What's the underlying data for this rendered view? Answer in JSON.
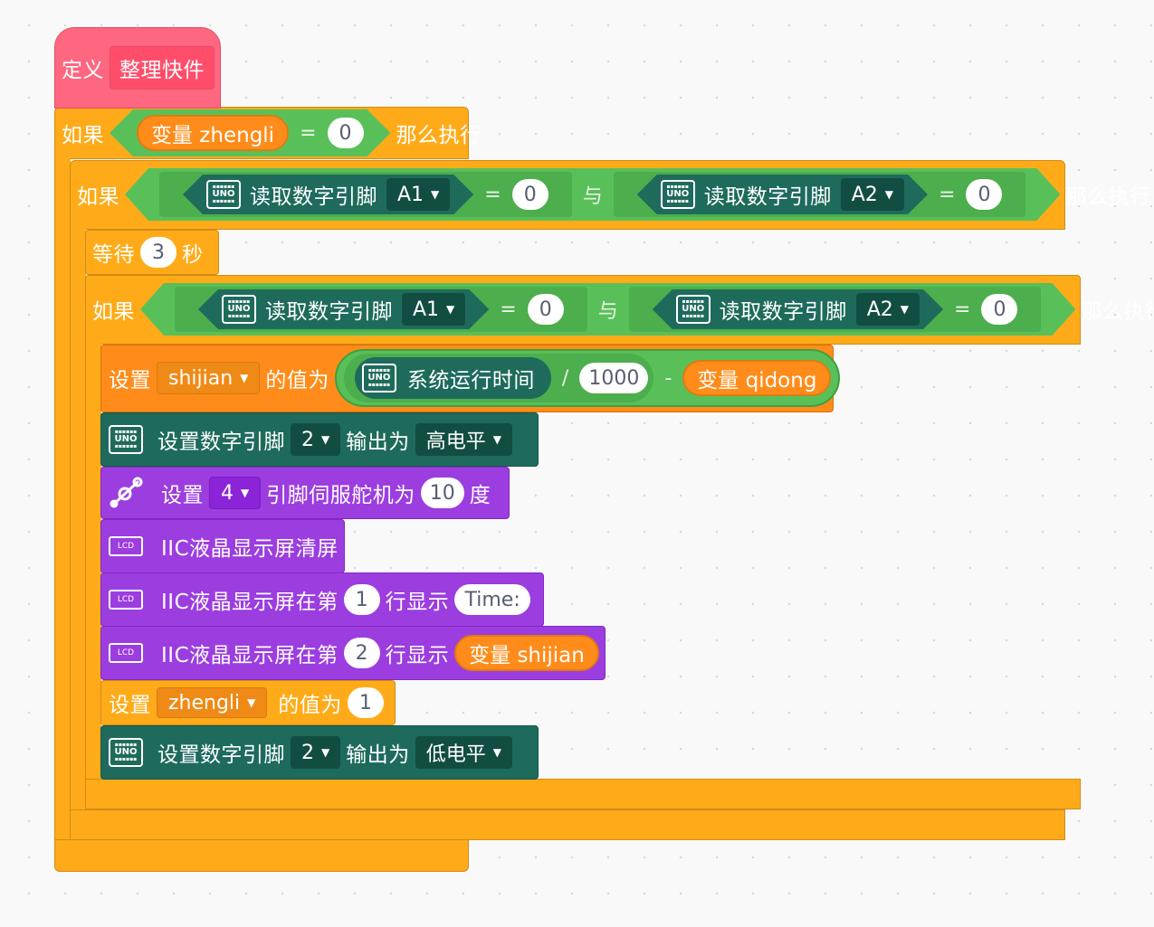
{
  "define": {
    "keyword": "定义",
    "name": "整理快件"
  },
  "outer_if": {
    "keyword": "如果",
    "variable": "变量 zhengli",
    "eq": "=",
    "value": "0",
    "then": "那么执行"
  },
  "if2": {
    "keyword": "如果",
    "left": {
      "label": "读取数字引脚",
      "pin": "A1",
      "eq": "=",
      "value": "0"
    },
    "and": "与",
    "right": {
      "label": "读取数字引脚",
      "pin": "A2",
      "eq": "=",
      "value": "0"
    },
    "then": "那么执行"
  },
  "wait": {
    "keyword": "等待",
    "value": "3",
    "unit": "秒"
  },
  "if3": {
    "keyword": "如果",
    "left": {
      "label": "读取数字引脚",
      "pin": "A1",
      "eq": "=",
      "value": "0"
    },
    "and": "与",
    "right": {
      "label": "读取数字引脚",
      "pin": "A2",
      "eq": "=",
      "value": "0"
    },
    "then": "那么执行"
  },
  "set_shijian": {
    "keyword": "设置",
    "var": "shijian",
    "value_of": "的值为",
    "runtime": "系统运行时间",
    "div": "/",
    "divisor": "1000",
    "minus": "-",
    "var2": "变量 qidong"
  },
  "digital_high": {
    "label": "设置数字引脚",
    "pin": "2",
    "output": "输出为",
    "level": "高电平"
  },
  "servo": {
    "keyword": "设置",
    "pin": "4",
    "label": "引脚伺服舵机为",
    "value": "10",
    "unit": "度"
  },
  "lcd_clear": {
    "label": "IIC液晶显示屏清屏"
  },
  "lcd_line1": {
    "label": "IIC液晶显示屏在第",
    "line": "1",
    "show": "行显示",
    "text": "Time:"
  },
  "lcd_line2": {
    "label": "IIC液晶显示屏在第",
    "line": "2",
    "show": "行显示",
    "var": "变量 shijian"
  },
  "set_zhengli": {
    "keyword": "设置",
    "var": "zhengli",
    "value_of": "的值为",
    "value": "1"
  },
  "digital_low": {
    "label": "设置数字引脚",
    "pin": "2",
    "output": "输出为",
    "level": "低电平"
  },
  "icons": {
    "uno": "UNO",
    "lcd": "LCD"
  },
  "colors": {
    "pink": "#ff6680",
    "orange": "#ffab19",
    "green": "#59c059",
    "teal": "#1e6b5c",
    "purple": "#9c3de0"
  }
}
